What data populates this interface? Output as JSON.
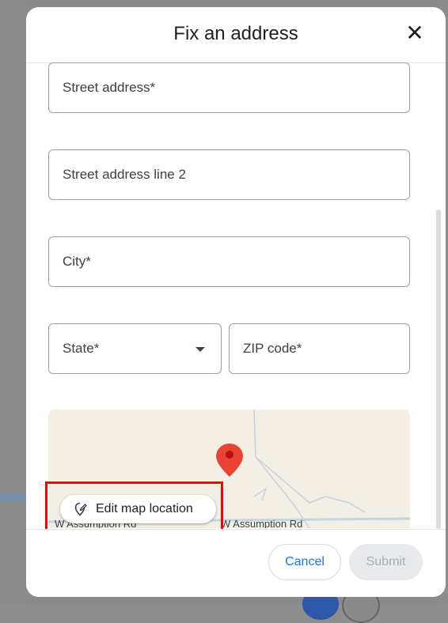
{
  "dialog": {
    "title": "Fix an address",
    "close_icon": "close-icon"
  },
  "form": {
    "street_address": {
      "placeholder": "Street address*"
    },
    "street_address_2": {
      "placeholder": "Street address line 2"
    },
    "city": {
      "placeholder": "City*"
    },
    "state": {
      "placeholder": "State*"
    },
    "zip": {
      "placeholder": "ZIP code*"
    }
  },
  "map": {
    "road_label_left": "W Assumption Rd",
    "road_label_right": "W Assumption Rd",
    "pin_color": "#ea4335",
    "edit_button_label": "Edit map location",
    "edit_button_icon": "edit-location-icon"
  },
  "footer": {
    "cancel_label": "Cancel",
    "submit_label": "Submit"
  },
  "colors": {
    "accent": "#1a73e8",
    "highlight": "#ff0000"
  }
}
